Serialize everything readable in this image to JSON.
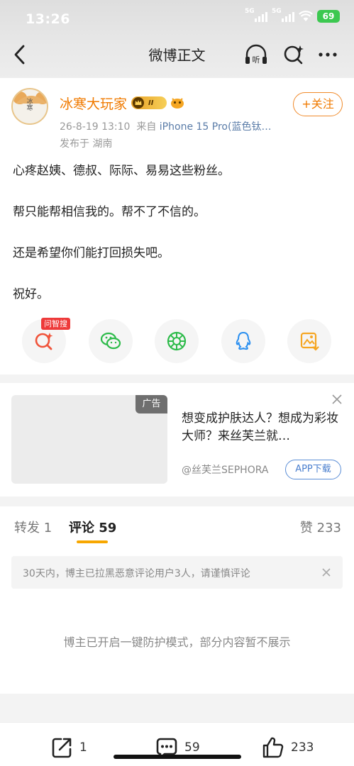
{
  "status": {
    "time": "13:26",
    "battery": "69",
    "net1": "5G",
    "net2": "5G"
  },
  "nav": {
    "title": "微博正文"
  },
  "post": {
    "avatar_text": "冰寒大玩家",
    "username": "冰寒大玩家",
    "vip_level": "II",
    "date": "26-8-19 13:10",
    "source_prefix": "来自",
    "device": "iPhone 15 Pro(蓝色钛…",
    "location": "发布于 湖南",
    "follow_label": "+关注",
    "paragraphs": [
      "心疼赵姨、德叔、际际、易易这些粉丝。",
      "帮只能帮相信我的。帮不了不信的。",
      "还是希望你们能打回损失吧。",
      "祝好。"
    ],
    "ai_tag": "问智搜"
  },
  "ad": {
    "tag": "广告",
    "text": "想变成护肤达人？想成为彩妆大师？来丝芙兰就…",
    "source": "@丝芙兰SEPHORA",
    "download_label": "APP下载"
  },
  "tabs": {
    "repost": "转发 1",
    "comments": "评论 59",
    "likes": "赞 233"
  },
  "comments": {
    "notice": "30天内，博主已拉黑恶意评论用户3人，请谨慎评论",
    "protect": "博主已开启一键防护模式，部分内容暂不展示"
  },
  "bottom": {
    "repost_count": "1",
    "comment_count": "59",
    "like_count": "233"
  }
}
